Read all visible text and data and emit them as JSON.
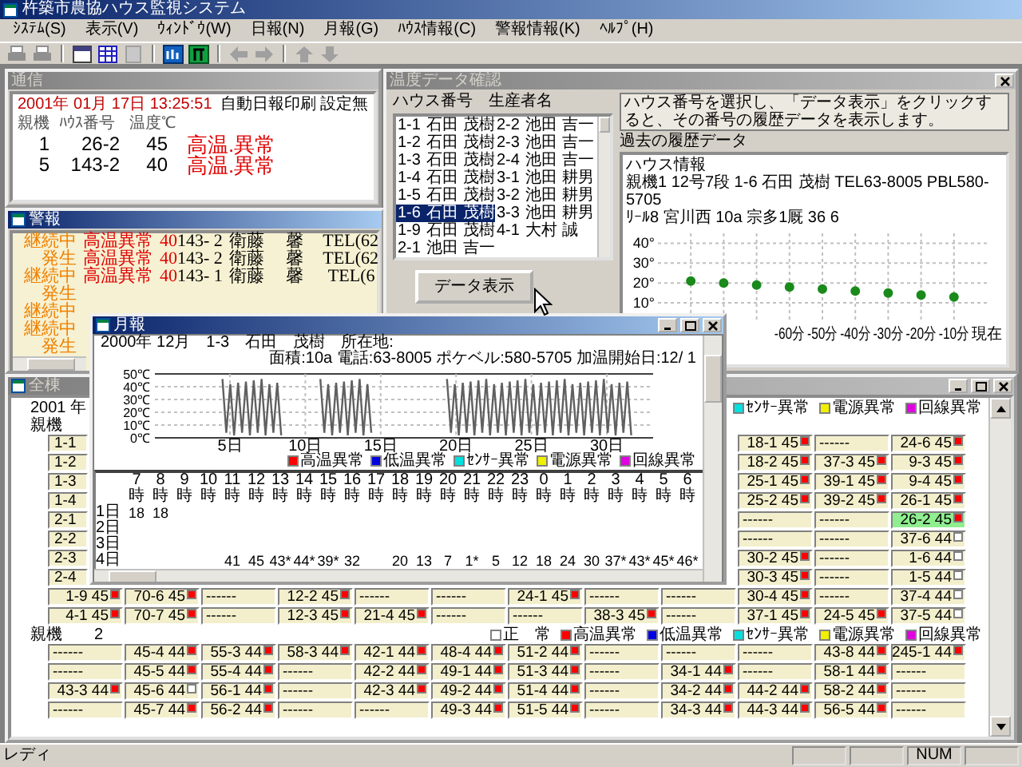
{
  "app": {
    "title": "杵築市農協ハウス監視システム"
  },
  "menu": [
    "ｼｽﾃﾑ(S)",
    "表示(V)",
    "ｳｨﾝﾄﾞｳ(W)",
    "日報(N)",
    "月報(G)",
    "ﾊｳｽ情報(C)",
    "警報情報(K)",
    "ﾍﾙﾌﾟ(H)"
  ],
  "comm_window": {
    "title": "通信",
    "active": false,
    "datetime": "2001年 01月 17日 13:25:51",
    "notice": "自動日報印刷 設定無",
    "columns": [
      "親機",
      "ﾊｳｽ番号",
      "温度℃"
    ],
    "rows": [
      {
        "unit": "1",
        "house": "26-2",
        "temp": "45",
        "status": "高温.異常"
      },
      {
        "unit": "5",
        "house": "143-2",
        "temp": "40",
        "status": "高温.異常"
      }
    ]
  },
  "alarm_window": {
    "title": "警報",
    "active": true,
    "rows": [
      {
        "status": "継続中",
        "type": "高温異常",
        "temp": "40",
        "house": "143- 2",
        "name": "衛藤　 馨",
        "tel": "TEL(62"
      },
      {
        "status": "発生",
        "type": "高温異常",
        "temp": "40",
        "house": "143- 2",
        "name": "衛藤　 馨",
        "tel": "TEL(62"
      },
      {
        "status": "継続中",
        "type": "高温異常",
        "temp": "40",
        "house": "143- 1",
        "name": "衛藤　 馨",
        "tel": "TEL(6"
      },
      {
        "status": "発生"
      },
      {
        "status": "継続中"
      },
      {
        "status": "継続中"
      },
      {
        "status": "発生"
      }
    ]
  },
  "temp_window": {
    "title": "温度データ確認",
    "active": false,
    "list_header": "ハウス番号　生産者名",
    "houses": [
      {
        "number": "1-1",
        "name": "石田 茂樹",
        "selected": false
      },
      {
        "number": "1-2",
        "name": "石田 茂樹",
        "selected": false
      },
      {
        "number": "1-3",
        "name": "石田 茂樹",
        "selected": false
      },
      {
        "number": "1-4",
        "name": "石田 茂樹",
        "selected": false
      },
      {
        "number": "1-5",
        "name": "石田 茂樹",
        "selected": false
      },
      {
        "number": "1-6",
        "name": "石田 茂樹",
        "selected": true
      },
      {
        "number": "1-9",
        "name": "石田 茂樹",
        "selected": false
      },
      {
        "number": "2-1",
        "name": "池田 吉一",
        "selected": false
      },
      {
        "number": "2-2",
        "name": "池田 吉一",
        "selected": false
      },
      {
        "number": "2-3",
        "name": "池田 吉一",
        "selected": false
      },
      {
        "number": "2-4",
        "name": "池田 吉一",
        "selected": false
      },
      {
        "number": "3-1",
        "name": "池田 耕男",
        "selected": false
      },
      {
        "number": "3-2",
        "name": "池田 耕男",
        "selected": false
      },
      {
        "number": "3-3",
        "name": "池田 耕男",
        "selected": false
      },
      {
        "number": "4-1",
        "name": "大村 誠",
        "selected": false
      }
    ],
    "button": "データ表示",
    "hint": "ハウス番号を選択し、「データ表示」をクリックすると、その番号の履歴データを表示します。",
    "history_label": "過去の履歴データ",
    "house_info": [
      "ハウス情報",
      "親機1 12号7段 1-6 石田 茂樹 TEL63-8005 PBL580-5705",
      "ﾘｰﾙ8 宮川西 10a 宗多1厩 36 6"
    ],
    "chart_data": {
      "type": "scatter",
      "grid": true,
      "x": [
        -90,
        -80,
        -70,
        -60,
        -50,
        -40,
        -30,
        -20,
        -10
      ],
      "series": [
        {
          "color": "#1a8a1a",
          "values": [
            21,
            20,
            19,
            18,
            17,
            16,
            15,
            14,
            13
          ]
        }
      ],
      "xlim": [
        -100,
        0
      ],
      "ylim": [
        0,
        45
      ],
      "yticks": [
        {
          "value": 10,
          "label": "10°"
        },
        {
          "value": 20,
          "label": "20°"
        },
        {
          "value": 30,
          "label": "30°"
        },
        {
          "value": 40,
          "label": "40°"
        }
      ],
      "xticks": [
        {
          "value": -60,
          "label": "-60分"
        },
        {
          "value": -50,
          "label": "-50分"
        },
        {
          "value": -40,
          "label": "-40分"
        },
        {
          "value": -30,
          "label": "-30分"
        },
        {
          "value": -20,
          "label": "-20分"
        },
        {
          "value": -10,
          "label": "-10分"
        },
        {
          "value": 0,
          "label": "現在"
        }
      ]
    }
  },
  "overview_window": {
    "title": "全棟",
    "active": false,
    "year": "2001 年",
    "legend": [
      {
        "label": "ｾﾝｻｰ異常",
        "color": "#00e0e0"
      },
      {
        "label": "電源異常",
        "color": "#f0f000"
      },
      {
        "label": "回線異常",
        "color": "#e000e0"
      }
    ],
    "groups": [
      {
        "label": "親機",
        "rows": [
          {
            "cells": [
              {
                "kind": "partial",
                "text": "1-1"
              },
              {
                "kind": "covered"
              },
              {
                "kind": "covered"
              },
              {
                "kind": "covered"
              },
              {
                "kind": "covered"
              },
              {
                "kind": "covered"
              },
              {
                "kind": "covered"
              },
              {
                "kind": "covered"
              },
              {
                "kind": "covered"
              },
              {
                "kind": "house",
                "text": "18-1 45",
                "alarm": true,
                "highlight": false
              },
              {
                "kind": "empty",
                "text": "------"
              },
              {
                "kind": "house",
                "text": "24-6 45",
                "alarm": true,
                "highlight": false
              }
            ]
          },
          {
            "cells": [
              {
                "kind": "partial",
                "text": "1-2"
              },
              {
                "kind": "covered"
              },
              {
                "kind": "covered"
              },
              {
                "kind": "covered"
              },
              {
                "kind": "covered"
              },
              {
                "kind": "covered"
              },
              {
                "kind": "covered"
              },
              {
                "kind": "covered"
              },
              {
                "kind": "covered"
              },
              {
                "kind": "house",
                "text": "18-2 45",
                "alarm": true,
                "highlight": false
              },
              {
                "kind": "house",
                "text": "37-3 45",
                "alarm": true,
                "highlight": false
              },
              {
                "kind": "house",
                "text": "9-3 45",
                "alarm": true,
                "highlight": false
              }
            ]
          },
          {
            "cells": [
              {
                "kind": "partial",
                "text": "1-3"
              },
              {
                "kind": "covered"
              },
              {
                "kind": "covered"
              },
              {
                "kind": "covered"
              },
              {
                "kind": "covered"
              },
              {
                "kind": "covered"
              },
              {
                "kind": "covered"
              },
              {
                "kind": "covered"
              },
              {
                "kind": "covered"
              },
              {
                "kind": "house",
                "text": "25-1 45",
                "alarm": true,
                "highlight": false
              },
              {
                "kind": "house",
                "text": "39-1 45",
                "alarm": true,
                "highlight": false
              },
              {
                "kind": "house",
                "text": "9-4 45",
                "alarm": true,
                "highlight": false
              }
            ]
          },
          {
            "cells": [
              {
                "kind": "partial",
                "text": "1-4"
              },
              {
                "kind": "covered"
              },
              {
                "kind": "covered"
              },
              {
                "kind": "covered"
              },
              {
                "kind": "covered"
              },
              {
                "kind": "covered"
              },
              {
                "kind": "covered"
              },
              {
                "kind": "covered"
              },
              {
                "kind": "covered"
              },
              {
                "kind": "house",
                "text": "25-2 45",
                "alarm": true,
                "highlight": false
              },
              {
                "kind": "house",
                "text": "39-2 45",
                "alarm": true,
                "highlight": false
              },
              {
                "kind": "house",
                "text": "26-1 45",
                "alarm": true,
                "highlight": false
              }
            ]
          },
          {
            "cells": [
              {
                "kind": "partial",
                "text": "2-1"
              },
              {
                "kind": "covered"
              },
              {
                "kind": "covered"
              },
              {
                "kind": "covered"
              },
              {
                "kind": "covered"
              },
              {
                "kind": "covered"
              },
              {
                "kind": "covered"
              },
              {
                "kind": "covered"
              },
              {
                "kind": "covered"
              },
              {
                "kind": "empty",
                "text": "------"
              },
              {
                "kind": "empty",
                "text": "------"
              },
              {
                "kind": "house",
                "text": "26-2 45",
                "alarm": true,
                "highlight": true
              }
            ]
          },
          {
            "cells": [
              {
                "kind": "partial",
                "text": "2-2"
              },
              {
                "kind": "covered"
              },
              {
                "kind": "covered"
              },
              {
                "kind": "covered"
              },
              {
                "kind": "covered"
              },
              {
                "kind": "covered"
              },
              {
                "kind": "covered"
              },
              {
                "kind": "covered"
              },
              {
                "kind": "covered"
              },
              {
                "kind": "empty",
                "text": "------"
              },
              {
                "kind": "empty",
                "text": "------"
              },
              {
                "kind": "house",
                "text": "37-6 44",
                "alarm": false,
                "highlight": false
              }
            ]
          },
          {
            "cells": [
              {
                "kind": "partial",
                "text": "2-3"
              },
              {
                "kind": "covered"
              },
              {
                "kind": "covered"
              },
              {
                "kind": "covered"
              },
              {
                "kind": "covered"
              },
              {
                "kind": "covered"
              },
              {
                "kind": "covered"
              },
              {
                "kind": "covered"
              },
              {
                "kind": "covered"
              },
              {
                "kind": "house",
                "text": "30-2 45",
                "alarm": true,
                "highlight": false
              },
              {
                "kind": "empty",
                "text": "------"
              },
              {
                "kind": "house",
                "text": "1-6 44",
                "alarm": false,
                "highlight": false
              }
            ]
          },
          {
            "cells": [
              {
                "kind": "partial",
                "text": "2-4"
              },
              {
                "kind": "covered"
              },
              {
                "kind": "covered"
              },
              {
                "kind": "covered"
              },
              {
                "kind": "covered"
              },
              {
                "kind": "covered"
              },
              {
                "kind": "covered"
              },
              {
                "kind": "covered"
              },
              {
                "kind": "covered"
              },
              {
                "kind": "house",
                "text": "30-3 45",
                "alarm": true,
                "highlight": false
              },
              {
                "kind": "empty",
                "text": "------"
              },
              {
                "kind": "house",
                "text": "1-5 44",
                "alarm": false,
                "highlight": false
              }
            ]
          },
          {
            "cells": [
              {
                "kind": "house",
                "text": "1-9 45",
                "alarm": true,
                "highlight": false
              },
              {
                "kind": "house",
                "text": "70-6 45",
                "alarm": true,
                "highlight": false
              },
              {
                "kind": "empty",
                "text": "------"
              },
              {
                "kind": "house",
                "text": "12-2 45",
                "alarm": true,
                "highlight": false
              },
              {
                "kind": "empty",
                "text": "------"
              },
              {
                "kind": "empty",
                "text": "------"
              },
              {
                "kind": "house",
                "text": "24-1 45",
                "alarm": true,
                "highlight": false
              },
              {
                "kind": "empty",
                "text": "------"
              },
              {
                "kind": "empty",
                "text": "------"
              },
              {
                "kind": "house",
                "text": "30-4 45",
                "alarm": true,
                "highlight": false
              },
              {
                "kind": "empty",
                "text": "------"
              },
              {
                "kind": "house",
                "text": "37-4 44",
                "alarm": false,
                "highlight": false
              }
            ]
          },
          {
            "cells": [
              {
                "kind": "house",
                "text": "4-1 45",
                "alarm": true,
                "highlight": false
              },
              {
                "kind": "house",
                "text": "70-7 45",
                "alarm": true,
                "highlight": false
              },
              {
                "kind": "empty",
                "text": "------"
              },
              {
                "kind": "house",
                "text": "12-3 45",
                "alarm": true,
                "highlight": false
              },
              {
                "kind": "house",
                "text": "21-4 45",
                "alarm": true,
                "highlight": false
              },
              {
                "kind": "empty",
                "text": "------"
              },
              {
                "kind": "empty",
                "text": "------"
              },
              {
                "kind": "house",
                "text": "38-3 45",
                "alarm": true,
                "highlight": false
              },
              {
                "kind": "empty",
                "text": "------"
              },
              {
                "kind": "house",
                "text": "37-1 45",
                "alarm": true,
                "highlight": false
              },
              {
                "kind": "house",
                "text": "24-5 45",
                "alarm": true,
                "highlight": false
              },
              {
                "kind": "house",
                "text": "37-5 44",
                "alarm": false,
                "highlight": false
              }
            ]
          }
        ]
      },
      {
        "label": "親機　　2",
        "legend": [
          {
            "label": "正　常",
            "color": "#ffffff"
          },
          {
            "label": "高温異常",
            "color": "#ff0000"
          },
          {
            "label": "低温異常",
            "color": "#0000e0"
          },
          {
            "label": "ｾﾝｻｰ異常",
            "color": "#00e0e0"
          },
          {
            "label": "電源異常",
            "color": "#f0f000"
          },
          {
            "label": "回線異常",
            "color": "#e000e0"
          }
        ],
        "rows": [
          {
            "cells": [
              {
                "kind": "empty",
                "text": "------"
              },
              {
                "kind": "house",
                "text": "45-4 44",
                "alarm": true,
                "highlight": false
              },
              {
                "kind": "house",
                "text": "55-3 44",
                "alarm": true,
                "highlight": false
              },
              {
                "kind": "house",
                "text": "58-3 44",
                "alarm": true,
                "highlight": false
              },
              {
                "kind": "house",
                "text": "42-1 44",
                "alarm": true,
                "highlight": false
              },
              {
                "kind": "house",
                "text": "48-4 44",
                "alarm": true,
                "highlight": false
              },
              {
                "kind": "house",
                "text": "51-2 44",
                "alarm": true,
                "highlight": false
              },
              {
                "kind": "empty",
                "text": "------"
              },
              {
                "kind": "empty",
                "text": "------"
              },
              {
                "kind": "empty",
                "text": "------"
              },
              {
                "kind": "house",
                "text": "43-8 44",
                "alarm": true,
                "highlight": false
              },
              {
                "kind": "house",
                "text": "245-1 44",
                "alarm": true,
                "highlight": false
              }
            ]
          },
          {
            "cells": [
              {
                "kind": "empty",
                "text": "------"
              },
              {
                "kind": "house",
                "text": "45-5 44",
                "alarm": true,
                "highlight": false
              },
              {
                "kind": "house",
                "text": "55-4 44",
                "alarm": true,
                "highlight": false
              },
              {
                "kind": "empty",
                "text": "------"
              },
              {
                "kind": "house",
                "text": "42-2 44",
                "alarm": true,
                "highlight": false
              },
              {
                "kind": "house",
                "text": "49-1 44",
                "alarm": true,
                "highlight": false
              },
              {
                "kind": "house",
                "text": "51-3 44",
                "alarm": true,
                "highlight": false
              },
              {
                "kind": "empty",
                "text": "------"
              },
              {
                "kind": "house",
                "text": "34-1 44",
                "alarm": true,
                "highlight": false
              },
              {
                "kind": "empty",
                "text": "------"
              },
              {
                "kind": "house",
                "text": "58-1 44",
                "alarm": true,
                "highlight": false
              },
              {
                "kind": "empty",
                "text": "------"
              }
            ]
          },
          {
            "cells": [
              {
                "kind": "house",
                "text": "43-3 44",
                "alarm": true,
                "highlight": false
              },
              {
                "kind": "house",
                "text": "45-6 44",
                "alarm": false,
                "highlight": false
              },
              {
                "kind": "house",
                "text": "56-1 44",
                "alarm": true,
                "highlight": false
              },
              {
                "kind": "empty",
                "text": "------"
              },
              {
                "kind": "house",
                "text": "42-3 44",
                "alarm": true,
                "highlight": false
              },
              {
                "kind": "house",
                "text": "49-2 44",
                "alarm": true,
                "highlight": false
              },
              {
                "kind": "house",
                "text": "51-4 44",
                "alarm": true,
                "highlight": false
              },
              {
                "kind": "empty",
                "text": "------"
              },
              {
                "kind": "house",
                "text": "34-2 44",
                "alarm": true,
                "highlight": false
              },
              {
                "kind": "house",
                "text": "44-2 44",
                "alarm": true,
                "highlight": false
              },
              {
                "kind": "house",
                "text": "58-2 44",
                "alarm": true,
                "highlight": false
              },
              {
                "kind": "empty",
                "text": "------"
              }
            ]
          },
          {
            "cells": [
              {
                "kind": "empty",
                "text": "------"
              },
              {
                "kind": "house",
                "text": "45-7 44",
                "alarm": true,
                "highlight": false
              },
              {
                "kind": "house",
                "text": "56-2 44",
                "alarm": true,
                "highlight": false
              },
              {
                "kind": "empty",
                "text": "------"
              },
              {
                "kind": "empty",
                "text": "------"
              },
              {
                "kind": "house",
                "text": "49-3 44",
                "alarm": true,
                "highlight": false
              },
              {
                "kind": "house",
                "text": "51-5 44",
                "alarm": true,
                "highlight": false
              },
              {
                "kind": "empty",
                "text": "------"
              },
              {
                "kind": "house",
                "text": "34-3 44",
                "alarm": true,
                "highlight": false
              },
              {
                "kind": "house",
                "text": "44-3 44",
                "alarm": true,
                "highlight": false
              },
              {
                "kind": "house",
                "text": "56-5 44",
                "alarm": true,
                "highlight": false
              },
              {
                "kind": "empty",
                "text": "------"
              }
            ]
          }
        ]
      }
    ]
  },
  "monthly_window": {
    "title": "月報",
    "active": true,
    "header_left": "2000年 12月　1-3　石田　茂樹　所在地:",
    "header_right": "面積:10a 電話:63-8005 ポケベル:580-5705 加温開始日:12/ 1",
    "y_labels": [
      "50℃",
      "40℃",
      "30℃",
      "20℃",
      "10℃",
      "0℃"
    ],
    "x_labels": [
      "5日",
      "10日",
      "15日",
      "20日",
      "25日",
      "30日"
    ],
    "legend": [
      {
        "label": "高温異常",
        "color": "#ff0000"
      },
      {
        "label": "低温異常",
        "color": "#0000e0"
      },
      {
        "label": "ｾﾝｻｰ異常",
        "color": "#00e0e0"
      },
      {
        "label": "電源異常",
        "color": "#f0f000"
      },
      {
        "label": "回線異常",
        "color": "#e000e0"
      }
    ],
    "table": {
      "columns": [
        "7時",
        "8時",
        "9時",
        "10時",
        "11時",
        "12時",
        "13時",
        "14時",
        "15時",
        "16時",
        "17時",
        "18時",
        "19時",
        "20時",
        "21時",
        "22時",
        "23時",
        "0時",
        "1時",
        "2時",
        "3時",
        "4時",
        "5時",
        "6時"
      ],
      "rows": [
        {
          "day": "1日",
          "cells": [
            {
              "kind": "value",
              "text": "18"
            },
            {
              "kind": "value",
              "text": "18"
            }
          ]
        },
        {
          "day": "2日"
        },
        {
          "day": "3日"
        },
        {
          "day": "4日",
          "cells": [
            {
              "kind": "blank"
            },
            {
              "kind": "blank"
            },
            {
              "kind": "blank"
            },
            {
              "kind": "blank"
            },
            {
              "kind": "value",
              "text": "41"
            },
            {
              "kind": "value",
              "text": "45"
            },
            {
              "kind": "value",
              "text": "43*"
            },
            {
              "kind": "value",
              "text": "44*"
            },
            {
              "kind": "value",
              "text": "39*"
            },
            {
              "kind": "value",
              "text": "32"
            },
            {
              "kind": "blank"
            },
            {
              "kind": "value",
              "text": "20"
            },
            {
              "kind": "value",
              "text": "13"
            },
            {
              "kind": "value",
              "text": "7"
            },
            {
              "kind": "value",
              "text": "1*"
            },
            {
              "kind": "value",
              "text": "5"
            },
            {
              "kind": "value",
              "text": "12"
            },
            {
              "kind": "value",
              "text": "18"
            },
            {
              "kind": "value",
              "text": "24"
            },
            {
              "kind": "value",
              "text": "30"
            },
            {
              "kind": "value",
              "text": "37*"
            },
            {
              "kind": "value",
              "text": "43*"
            },
            {
              "kind": "value",
              "text": "45*"
            },
            {
              "kind": "value",
              "text": "46*"
            }
          ]
        }
      ]
    }
  },
  "status_bar": {
    "text": "レディ",
    "indicators": [
      "NUM"
    ]
  }
}
